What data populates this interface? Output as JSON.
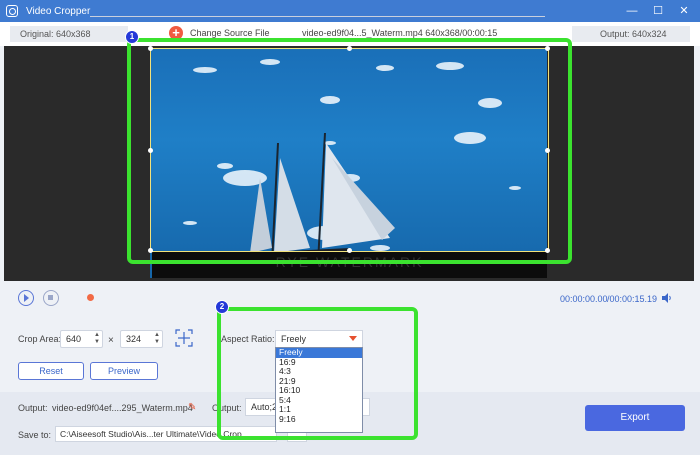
{
  "window": {
    "title": "Video Cropper",
    "minimize": "—",
    "maximize": "☐",
    "close": "✕"
  },
  "infobar": {
    "original": "Original: 640x368",
    "change_source": "Change Source File",
    "add_icon": "+",
    "file_info": "video-ed9f04...5_Waterm.mp4   640x368/00:00:15",
    "output": "Output: 640x324"
  },
  "preview": {
    "watermark_text": "RYE WATERMARK",
    "badge1": "1"
  },
  "player": {
    "current_time": "00:00:00.00",
    "total_time": "/00:00:15.19"
  },
  "crop": {
    "label": "Crop Area:",
    "width": "640",
    "times": "×",
    "height": "324",
    "reset_label": "Reset",
    "preview_label": "Preview"
  },
  "aspect": {
    "label": "Aspect Ratio:",
    "selected": "Freely",
    "badge2": "2",
    "options": [
      "Freely",
      "16:9",
      "4:3",
      "21:9",
      "16:10",
      "5:4",
      "1:1",
      "9:16"
    ]
  },
  "output_row": {
    "label": "Output:",
    "filename": "video-ed9f04ef....295_Waterm.mp4",
    "settings_label": "Output:",
    "settings_value": "Auto;24"
  },
  "save_row": {
    "label": "Save to:",
    "path": "C:\\Aiseesoft Studio\\Ais...ter Ultimate\\Video Crop",
    "folder_icon_text": "..."
  },
  "export": {
    "label": "Export"
  },
  "colors": {
    "accent": "#4a68e0",
    "highlight": "#3be22f",
    "badge": "#2439d8"
  }
}
